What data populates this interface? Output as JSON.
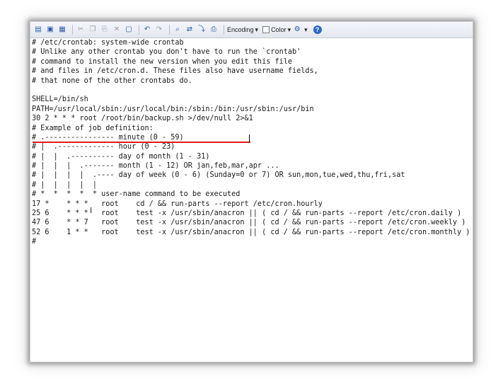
{
  "toolbar": {
    "encoding_label": "Encoding",
    "color_label": "Color",
    "icons": [
      "open-icon",
      "save-icon",
      "save-as-icon",
      "cut-icon",
      "copy-icon",
      "paste-icon",
      "delete-icon",
      "select-icon",
      "undo-icon",
      "redo-icon",
      "find-icon",
      "replace-icon",
      "goto-icon",
      "print-icon",
      "gear-icon",
      "help-icon"
    ]
  },
  "editor": {
    "lines": [
      "# /etc/crontab: system-wide crontab",
      "# Unlike any other crontab you don't have to run the `crontab'",
      "# command to install the new version when you edit this file",
      "# and files in /etc/cron.d. These files also have username fields,",
      "# that none of the other crontabs do.",
      "",
      "SHELL=/bin/sh",
      "PATH=/usr/local/sbin:/usr/local/bin:/sbin:/bin:/usr/sbin:/usr/bin",
      "30 2 * * * root /root/bin/backup.sh >/dev/null 2>&1",
      "# Example of job definition:",
      "# .---------------- minute (0 - 59)",
      "# |  .------------- hour (0 - 23)",
      "# |  |  .---------- day of month (1 - 31)",
      "# |  |  |  .------- month (1 - 12) OR jan,feb,mar,apr ...",
      "# |  |  |  |  .---- day of week (0 - 6) (Sunday=0 or 7) OR sun,mon,tue,wed,thu,fri,sat",
      "# |  |  |  |  |",
      "# *  *  *  *  * user-name command to be executed",
      "17 *    * * *   root    cd / && run-parts --report /etc/cron.hourly",
      "25 6    * * *   root    test -x /usr/sbin/anacron || ( cd / && run-parts --report /etc/cron.daily )",
      "47 6    * * 7   root    test -x /usr/sbin/anacron || ( cd / && run-parts --report /etc/cron.weekly )",
      "52 6    1 * *   root    test -x /usr/sbin/anacron || ( cd / && run-parts --report /etc/cron.monthly )",
      "#"
    ]
  }
}
